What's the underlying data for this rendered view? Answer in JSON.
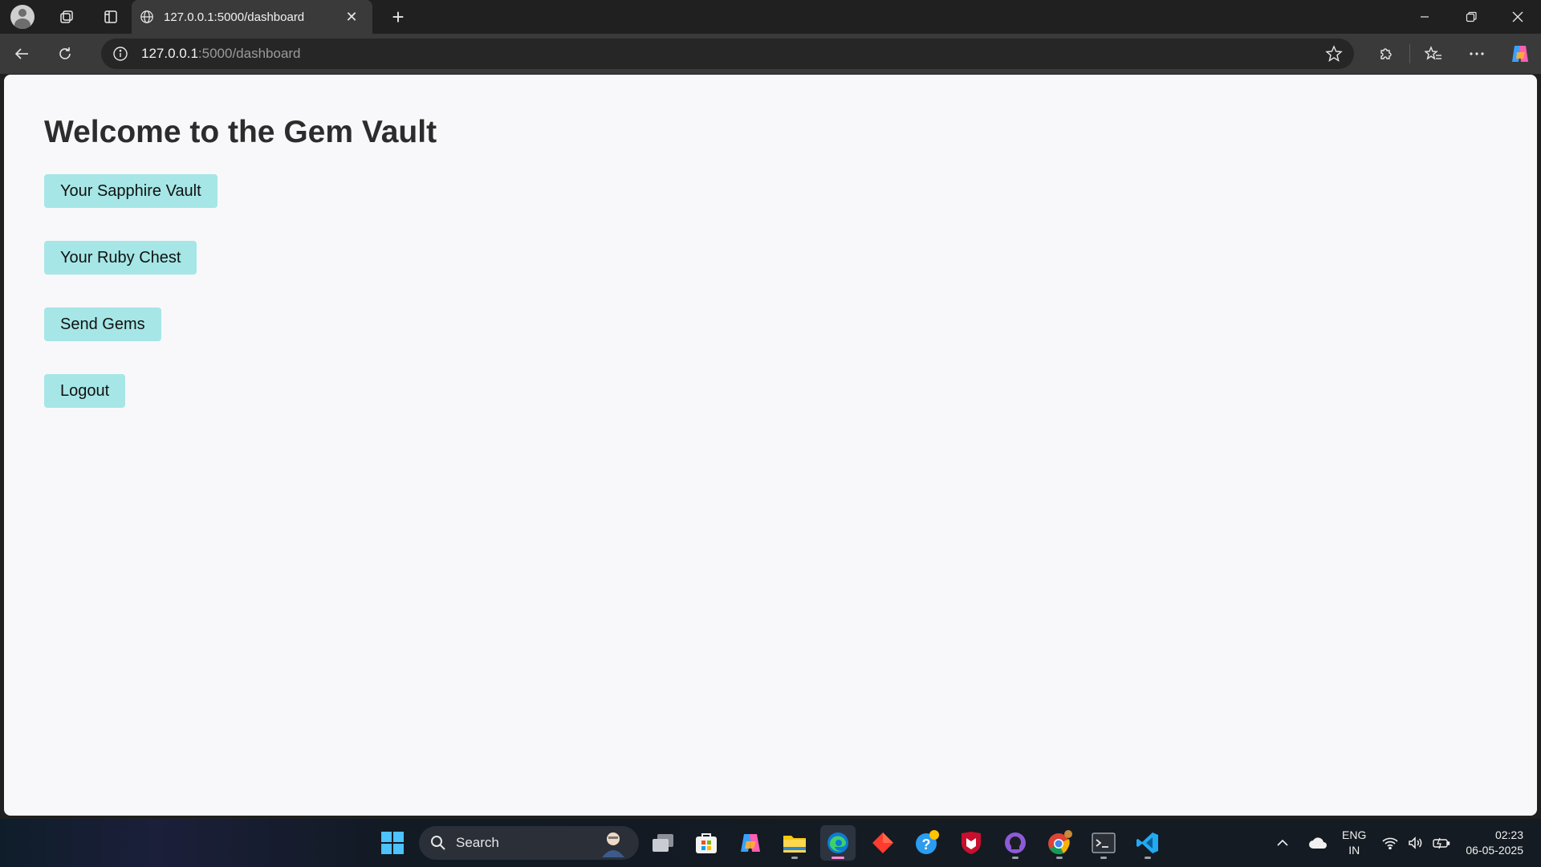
{
  "browser": {
    "tab_title": "127.0.0.1:5000/dashboard",
    "url_host": "127.0.0.1",
    "url_rest": ":5000/dashboard"
  },
  "page": {
    "heading": "Welcome to the Gem Vault",
    "buttons": [
      {
        "label": "Your Sapphire Vault"
      },
      {
        "label": "Your Ruby Chest"
      },
      {
        "label": "Send Gems"
      },
      {
        "label": "Logout"
      }
    ],
    "button_color": "#a6e6e6"
  },
  "taskbar": {
    "search_label": "Search",
    "lang_line1": "ENG",
    "lang_line2": "IN",
    "time": "02:23",
    "date": "06-05-2025"
  }
}
